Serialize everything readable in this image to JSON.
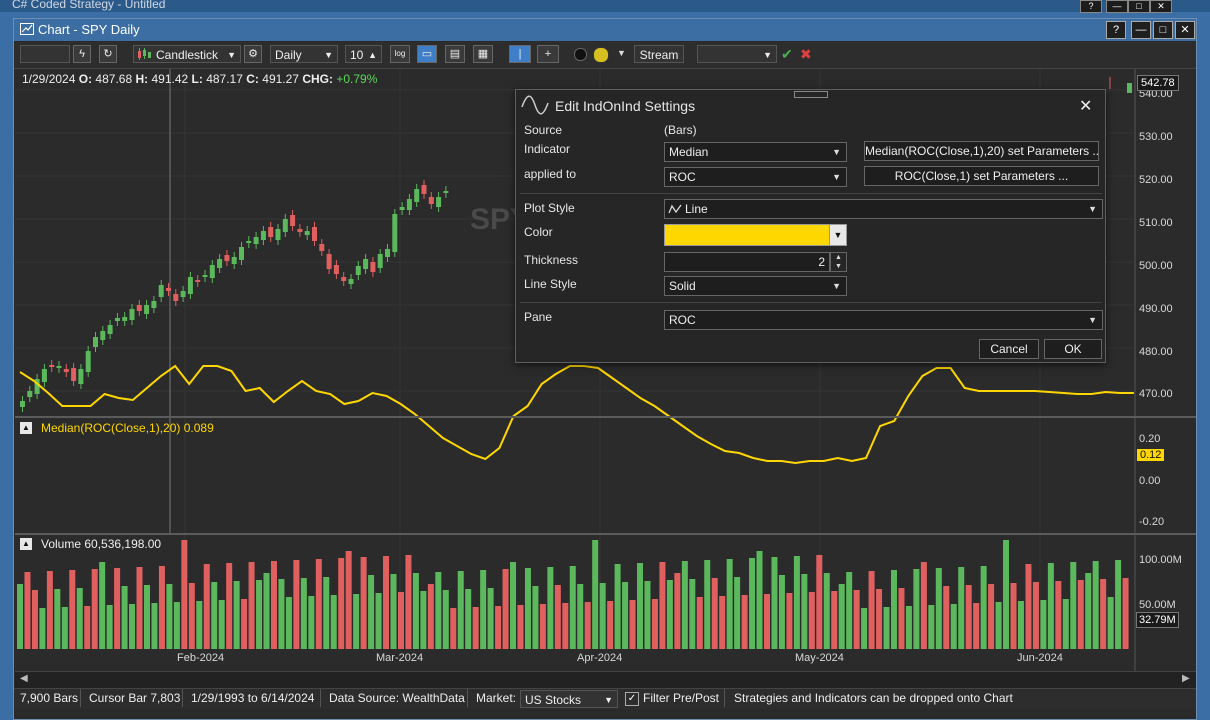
{
  "background_window": {
    "title": "C# Coded Strategy - Untitled"
  },
  "window": {
    "title": "Chart - SPY Daily",
    "help": "?",
    "minimize": "—",
    "maximize": "□",
    "close": "✕"
  },
  "toolbar": {
    "chart_style": "Candlestick",
    "scale": "Daily",
    "bars_value": "10",
    "log_label": "log",
    "stream_label": "Stream",
    "symbol_value": ""
  },
  "ohlc": {
    "date": "1/29/2024",
    "o_label": "O:",
    "o": "487.68",
    "h_label": "H:",
    "h": "491.42",
    "l_label": "L:",
    "l": "487.17",
    "c_label": "C:",
    "c": "491.27",
    "chg_label": "CHG:",
    "chg": "+0.79%"
  },
  "watermark": "SPY",
  "price_axis": {
    "ticks": [
      "540.00",
      "530.00",
      "520.00",
      "510.00",
      "500.00",
      "490.00",
      "480.00",
      "470.00"
    ],
    "last_price": "542.78"
  },
  "indicator_pane": {
    "label": "Median(ROC(Close,1),20) 0.089",
    "ticks": [
      "0.20",
      "0.00",
      "-0.20"
    ],
    "last_value": "0.12"
  },
  "volume_pane": {
    "label": "Volume 60,536,198.00",
    "ticks": [
      "100.00M",
      "50.00M"
    ],
    "last_value": "32.79M"
  },
  "x_axis": {
    "labels": [
      "Feb-2024",
      "Mar-2024",
      "Apr-2024",
      "May-2024",
      "Jun-2024"
    ]
  },
  "statusbar": {
    "bars": "7,900 Bars",
    "cursor": "Cursor Bar 7,803",
    "range": "1/29/1993 to 6/14/2024",
    "source": "Data Source: WealthData",
    "market_label": "Market:",
    "market_value": "US Stocks",
    "filter": "Filter Pre/Post",
    "hint": "Strategies and Indicators can be dropped onto Chart"
  },
  "dialog": {
    "title": "Edit IndOnInd Settings",
    "close": "✕",
    "source_label": "Source",
    "source_value": "(Bars)",
    "indicator_label": "Indicator",
    "indicator_value": "Median",
    "indicator_params": "Median(ROC(Close,1),20) set Parameters ...",
    "applied_label": "applied to",
    "applied_value": "ROC",
    "applied_params": "ROC(Close,1) set Parameters ...",
    "plot_style_label": "Plot Style",
    "plot_style_value": "Line",
    "color_label": "Color",
    "color_value": "#FFD700",
    "thickness_label": "Thickness",
    "thickness_value": "2",
    "line_style_label": "Line Style",
    "line_style_value": "Solid",
    "pane_label": "Pane",
    "pane_value": "ROC",
    "cancel": "Cancel",
    "ok": "OK"
  },
  "colors": {
    "up": "#5cb85c",
    "down": "#e06060",
    "indicator": "#ffd700",
    "accent": "#3c6ea3"
  }
}
